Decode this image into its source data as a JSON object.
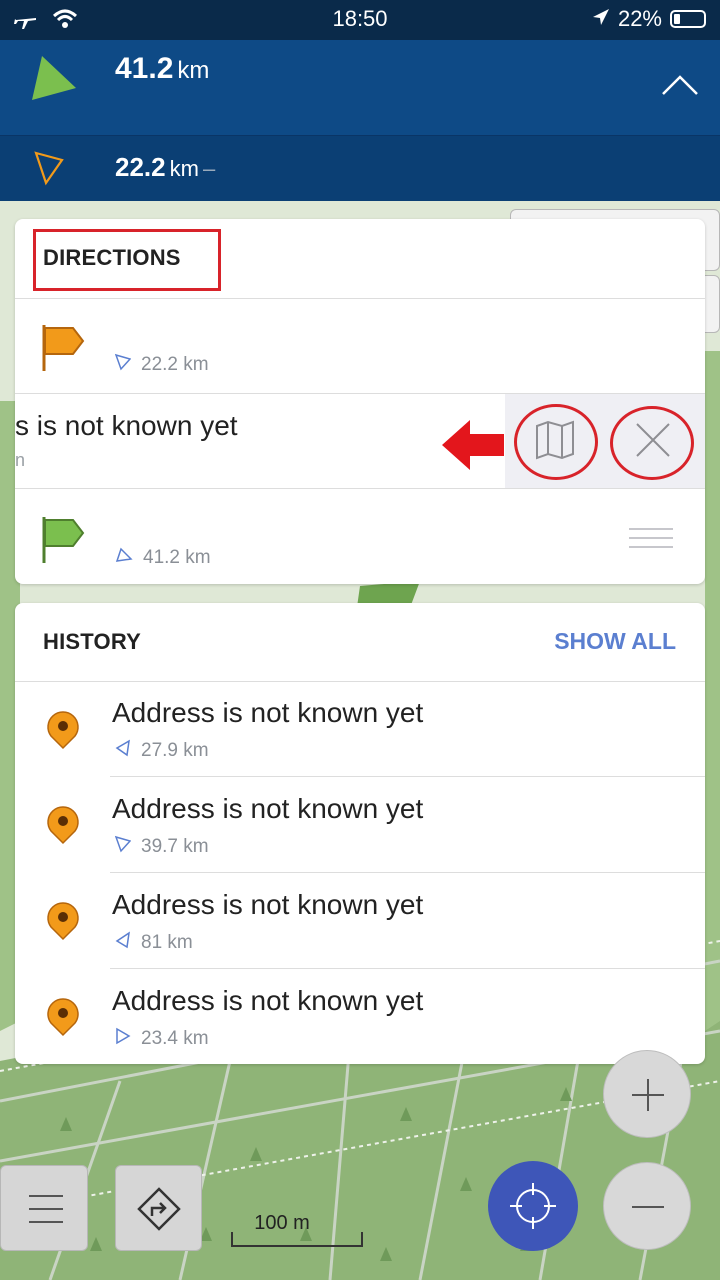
{
  "status_bar": {
    "time": "18:50",
    "battery": "22%"
  },
  "nav": {
    "distance_main_value": "41.2",
    "distance_main_unit": "km",
    "distance_sub_value": "22.2",
    "distance_sub_unit": "km",
    "distance_sub_suffix": "–"
  },
  "directions": {
    "title": "DIRECTIONS",
    "start": {
      "distance": "22.2 km"
    },
    "swiped_row": {
      "text": "s is not known yet",
      "subtext": "n"
    },
    "end": {
      "distance": "41.2 km"
    }
  },
  "history": {
    "title": "HISTORY",
    "show_all": "SHOW ALL",
    "items": [
      {
        "address": "Address is not known yet",
        "distance": "27.9 km"
      },
      {
        "address": "Address is not known yet",
        "distance": "39.7 km"
      },
      {
        "address": "Address is not known yet",
        "distance": "81 km"
      },
      {
        "address": "Address is not known yet",
        "distance": "23.4 km"
      }
    ]
  },
  "map": {
    "scale_label": "100 m"
  },
  "colors": {
    "header_blue": "#0e4a86",
    "accent_blue": "#5b7fd0",
    "annotation_red": "#d8232a",
    "orange": "#f29a1a",
    "green": "#7bbf4e"
  }
}
